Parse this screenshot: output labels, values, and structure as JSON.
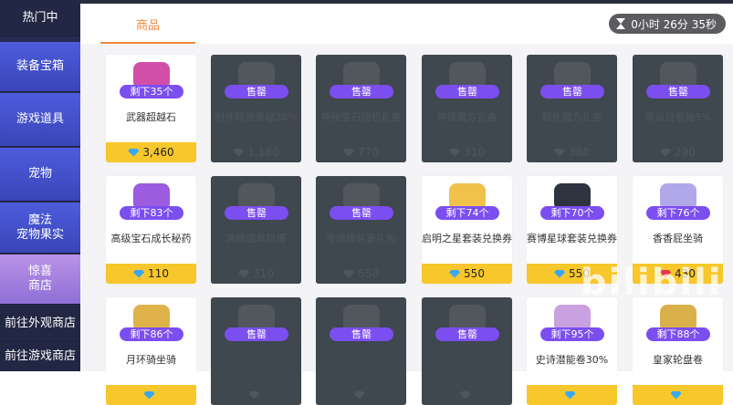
{
  "sidebar": {
    "items": [
      {
        "label": "热门中",
        "style": "dark"
      },
      {
        "label": "装备宝箱",
        "style": "blue"
      },
      {
        "label": "游戏道具",
        "style": "blue"
      },
      {
        "label": "宠物",
        "style": "blue"
      },
      {
        "label": "魔法\n宠物果实",
        "style": "blue"
      },
      {
        "label": "惊喜\n商店",
        "style": "active"
      },
      {
        "label": "前往外观商店",
        "style": "dark"
      },
      {
        "label": "前往游戏商店",
        "style": "dark"
      }
    ]
  },
  "tabs": [
    {
      "label": "商品"
    }
  ],
  "timer": {
    "text": "0小时 26分 35秒"
  },
  "colors": {
    "accent": "#f08a3c",
    "badge": "#7b4ef0",
    "price_bar": "#f7c72b",
    "sold_out": "#3f474f"
  },
  "items": [
    {
      "name": "武器超越石",
      "badge": "剩下35个",
      "price": "3,460",
      "gem": "blue",
      "sold_out": false,
      "art": "#d24fa8"
    },
    {
      "name": "附件释放卷轴30%",
      "badge": "售罄",
      "price": "1,180",
      "gem": "blue",
      "sold_out": true,
      "art": "#888"
    },
    {
      "name": "神秘宝石随机礼盒",
      "badge": "售罄",
      "price": "770",
      "gem": "blue",
      "sold_out": true,
      "art": "#888"
    },
    {
      "name": "神级魔方礼盒",
      "badge": "售罄",
      "price": "310",
      "gem": "blue",
      "sold_out": true,
      "art": "#888"
    },
    {
      "name": "额外魔方礼盒",
      "badge": "售罄",
      "price": "380",
      "gem": "blue",
      "sold_out": true,
      "art": "#888"
    },
    {
      "name": "幸运日卷轴5%",
      "badge": "售罄",
      "price": "290",
      "gem": "blue",
      "sold_out": true,
      "art": "#888"
    },
    {
      "name": "高级宝石成长秘药",
      "badge": "剩下83个",
      "price": "110",
      "gem": "blue",
      "sold_out": false,
      "art": "#9b5ce0"
    },
    {
      "name": "高级道具防爆",
      "badge": "售罄",
      "price": "310",
      "gem": "blue",
      "sold_out": true,
      "art": "#888"
    },
    {
      "name": "传说级装备礼包",
      "badge": "售罄",
      "price": "650",
      "gem": "blue",
      "sold_out": true,
      "art": "#888"
    },
    {
      "name": "启明之星套装兑换券",
      "badge": "剩下74个",
      "price": "550",
      "gem": "blue",
      "sold_out": false,
      "art": "#f1c24a"
    },
    {
      "name": "赛博星球套装兑换券",
      "badge": "剩下70个",
      "price": "550",
      "gem": "blue",
      "sold_out": false,
      "art": "#2e3340"
    },
    {
      "name": "香香屁坐骑",
      "badge": "剩下76个",
      "price": "430",
      "gem": "red",
      "sold_out": false,
      "art": "#b0a8e8"
    },
    {
      "name": "月环骑坐骑",
      "badge": "剩下86个",
      "price": "",
      "gem": "blue",
      "sold_out": false,
      "art": "#e0b24a"
    },
    {
      "name": "",
      "badge": "售罄",
      "price": "",
      "gem": "blue",
      "sold_out": true,
      "art": "#888"
    },
    {
      "name": "",
      "badge": "售罄",
      "price": "",
      "gem": "blue",
      "sold_out": true,
      "art": "#888"
    },
    {
      "name": "",
      "badge": "售罄",
      "price": "",
      "gem": "blue",
      "sold_out": true,
      "art": "#888"
    },
    {
      "name": "史诗潜能卷30%",
      "badge": "剩下95个",
      "price": "",
      "gem": "blue",
      "sold_out": false,
      "art": "#c9a0e0"
    },
    {
      "name": "皇家轮盘卷",
      "badge": "剩下88个",
      "price": "",
      "gem": "blue",
      "sold_out": false,
      "art": "#d9b04a"
    }
  ],
  "watermark": {
    "text": "bilibili"
  }
}
